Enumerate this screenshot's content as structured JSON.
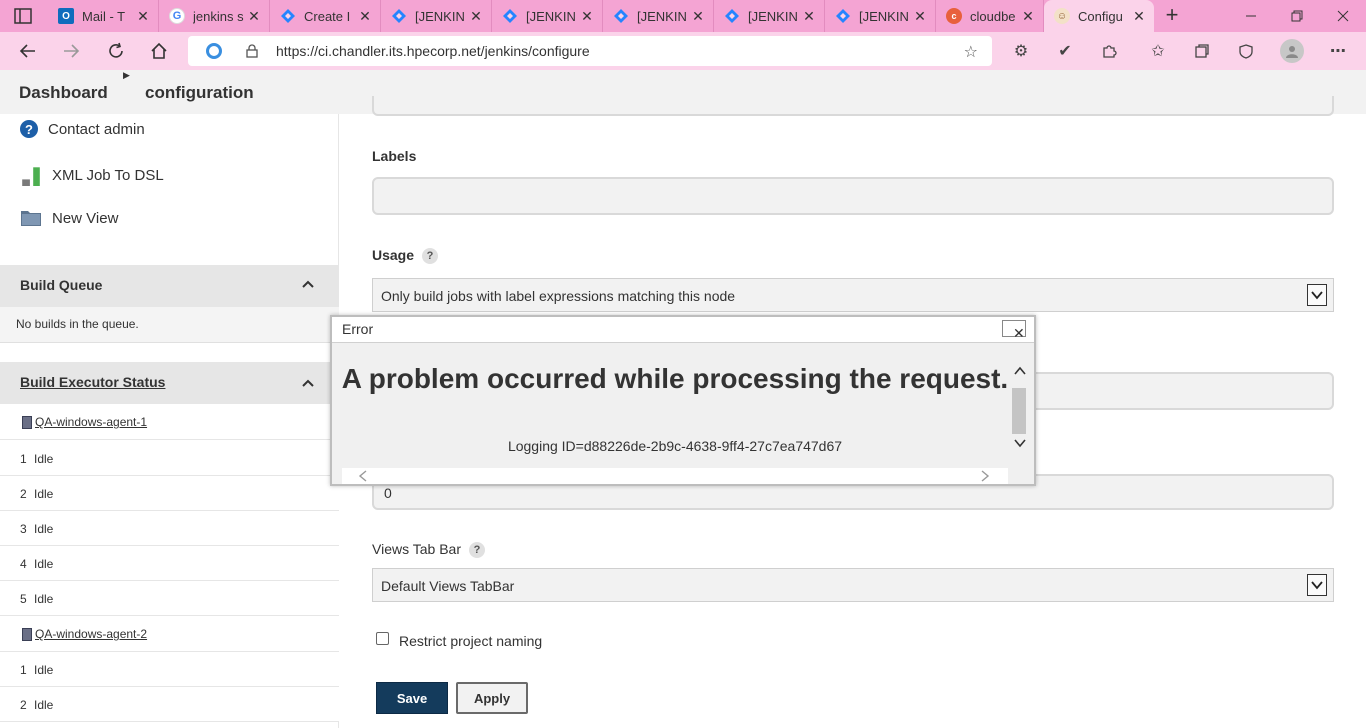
{
  "browser": {
    "tabs": [
      {
        "label": "Mail - T",
        "icon": "outlook-icon"
      },
      {
        "label": "jenkins s",
        "icon": "google-icon"
      },
      {
        "label": "Create I",
        "icon": "jira-icon"
      },
      {
        "label": "[JENKIN",
        "icon": "jira-icon"
      },
      {
        "label": "[JENKIN",
        "icon": "jira-icon"
      },
      {
        "label": "[JENKIN",
        "icon": "jira-icon"
      },
      {
        "label": "[JENKIN",
        "icon": "jira-icon"
      },
      {
        "label": "[JENKIN",
        "icon": "jira-icon"
      },
      {
        "label": "cloudbe",
        "icon": "cloudbees-icon"
      },
      {
        "label": "Configu",
        "icon": "jenkins-icon"
      }
    ],
    "active_tab_index": 9,
    "url": "https://ci.chandler.its.hpecorp.net/jenkins/configure"
  },
  "breadcrumb": {
    "dashboard": "Dashboard",
    "configuration": "configuration"
  },
  "sidebar": {
    "links": [
      {
        "label": "Contact admin",
        "icon": "help-icon"
      },
      {
        "label": "XML Job To DSL",
        "icon": "dsl-icon"
      },
      {
        "label": "New View",
        "icon": "folder-icon"
      }
    ],
    "build_queue": {
      "title": "Build Queue",
      "empty_text": "No builds in the queue."
    },
    "executor_status": {
      "title": "Build Executor Status",
      "agents": [
        {
          "name": "QA-windows-agent-1",
          "executors": [
            {
              "num": "1",
              "status": "Idle"
            },
            {
              "num": "2",
              "status": "Idle"
            },
            {
              "num": "3",
              "status": "Idle"
            },
            {
              "num": "4",
              "status": "Idle"
            },
            {
              "num": "5",
              "status": "Idle"
            }
          ]
        },
        {
          "name": "QA-windows-agent-2",
          "executors": [
            {
              "num": "1",
              "status": "Idle"
            },
            {
              "num": "2",
              "status": "Idle"
            }
          ]
        }
      ]
    }
  },
  "form": {
    "labels_label": "Labels",
    "labels_value": "",
    "usage_label": "Usage",
    "usage_value": "Only build jobs with label expressions matching this node",
    "quiet_value": "0",
    "views_tab_bar_label": "Views Tab Bar",
    "views_tab_bar_value": "Default Views TabBar",
    "help_glyph": "?",
    "restrict_label": "Restrict project naming",
    "restrict_checked": false,
    "save_label": "Save",
    "apply_label": "Apply"
  },
  "dialog": {
    "title": "Error",
    "close_glyph": "✕",
    "heading": "A problem occurred while processing the request.",
    "logging_id": "Logging ID=d88226de-2b9c-4638-9ff4-27c7ea747d67"
  },
  "colors": {
    "tabbar": "#f4a4d3",
    "addressbar": "#fbd3ea",
    "save_button": "#143b5c",
    "help_icon": "#1d5fa8"
  }
}
